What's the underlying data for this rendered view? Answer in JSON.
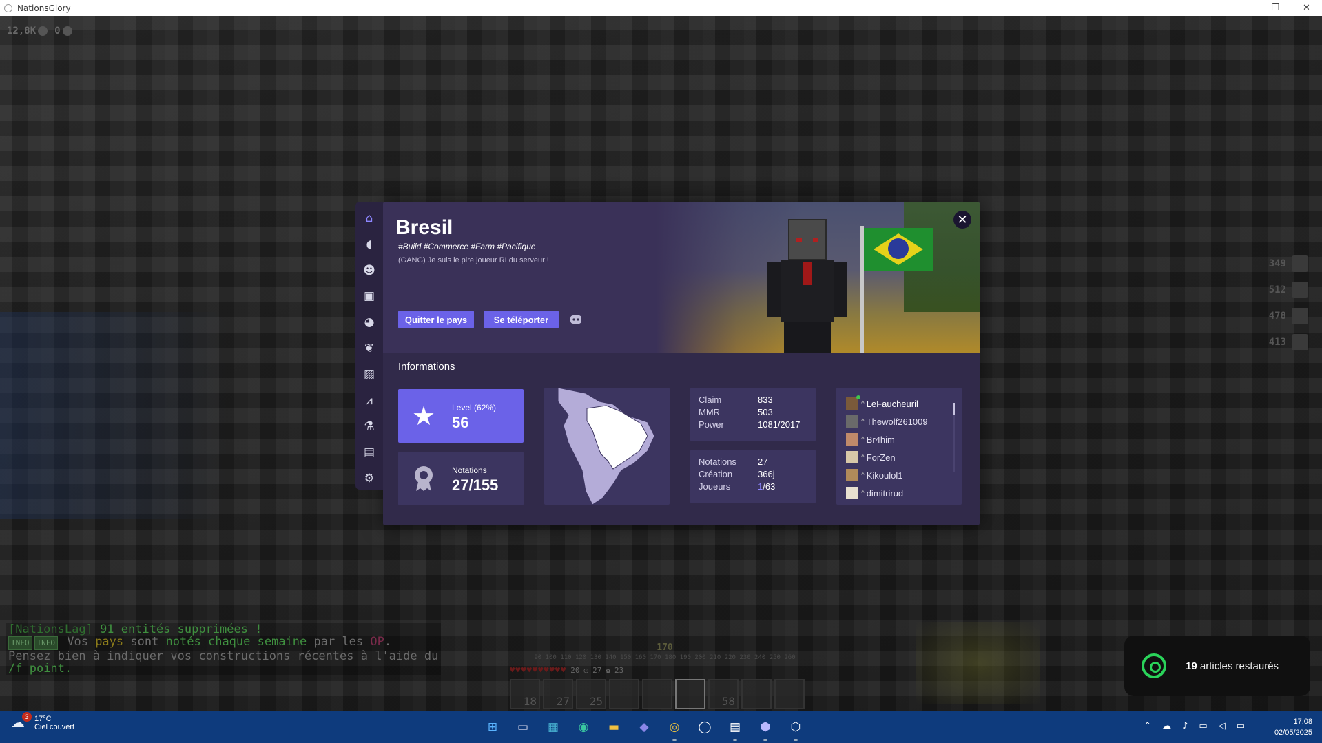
{
  "window": {
    "title": "NationsGlory",
    "minimize": "—",
    "restore": "❐",
    "close": "✕"
  },
  "hud": {
    "money": "12,8K",
    "points": "0"
  },
  "side_stats": [
    "349",
    "512",
    "478",
    "413"
  ],
  "chat": {
    "line1_prefix": "[NationsLag]",
    "line1_text": " 91 entités supprimées !",
    "line2_tag1": "INFO",
    "line2_tag2": "INFO",
    "line2_a": " Vos ",
    "line2_b": "pays",
    "line2_c": " sont ",
    "line2_d": "notés chaque semaine",
    "line2_e": " par les ",
    "line2_f": "OP",
    "line2_g": ".",
    "line3": " Pensez bien à indiquer vos constructions récentes à l'aide du",
    "line4": " /f point."
  },
  "hotbar": {
    "xp_level": "170",
    "compass_scale": "90  100 110 120 130 140 150 160 170 180 190 200 210 220 230 240 250 260",
    "health_value": "20",
    "stat_a": "27",
    "stat_b": "23",
    "slots": [
      "18",
      "27",
      "25",
      "",
      "",
      "",
      "58",
      "",
      ""
    ]
  },
  "nav": {
    "items": [
      {
        "icon": "home-icon",
        "glyph": "⌂"
      },
      {
        "icon": "piggy-bank-icon",
        "glyph": "◖"
      },
      {
        "icon": "users-icon",
        "glyph": "☻"
      },
      {
        "icon": "briefcase-icon",
        "glyph": "▣"
      },
      {
        "icon": "brain-icon",
        "glyph": "◕"
      },
      {
        "icon": "dove-icon",
        "glyph": "❦"
      },
      {
        "icon": "images-icon",
        "glyph": "▨"
      },
      {
        "icon": "chart-line-icon",
        "glyph": "⩘"
      },
      {
        "icon": "flask-icon",
        "glyph": "⚗"
      },
      {
        "icon": "scroll-icon",
        "glyph": "▤"
      },
      {
        "icon": "gear-icon",
        "glyph": "⚙"
      }
    ]
  },
  "nation": {
    "name": "Bresil",
    "tags": "#Build #Commerce #Farm #Pacifique",
    "description": "(GANG) Je suis le pire joueur RI du serveur !",
    "quit_label": "Quitter le pays",
    "teleport_label": "Se téléporter",
    "close_glyph": "✕"
  },
  "info": {
    "title": "Informations",
    "level_label": "Level (62%)",
    "level_value": "56",
    "level_progress": 0.62,
    "notations_label": "Notations",
    "notations_value": "27/155",
    "stats1": [
      {
        "k": "Claim",
        "v": "833"
      },
      {
        "k": "MMR",
        "v": "503"
      },
      {
        "k": "Power",
        "v": "1081/2017"
      }
    ],
    "stats2": [
      {
        "k": "Notations",
        "v": "27"
      },
      {
        "k": "Création",
        "v": "366j"
      }
    ],
    "players_label": "Joueurs",
    "players_online": "1",
    "players_total": "/63"
  },
  "players": [
    {
      "name": "LeFaucheuril",
      "rank": "^",
      "online": true
    },
    {
      "name": "Thewolf261009",
      "rank": "^",
      "online": false
    },
    {
      "name": "Br4him",
      "rank": "^",
      "online": false
    },
    {
      "name": "ForZen",
      "rank": "^",
      "online": false
    },
    {
      "name": "Kikoulol1",
      "rank": "^",
      "online": false
    },
    {
      "name": "dimitrirud",
      "rank": "^",
      "online": false
    }
  ],
  "toast": {
    "count": "19",
    "text": " articles restaurés"
  },
  "taskbar": {
    "weather_temp": "17°C",
    "weather_desc": "Ciel couvert",
    "weather_badge": "3",
    "apps": [
      "windows-start-icon",
      "file-explorer-window-icon",
      "store-icon",
      "edge-icon",
      "folder-icon",
      "teams-icon",
      "chrome-icon",
      "dell-icon",
      "word-icon",
      "nationsglory-launcher-icon",
      "nationsglory-game-icon"
    ],
    "time": "17:08",
    "date": "02/05/2025"
  },
  "colors": {
    "accent": "#6b62e8",
    "panel": "#312a4a",
    "card": "#3c3560",
    "taskbar": "#0e3b7d"
  }
}
